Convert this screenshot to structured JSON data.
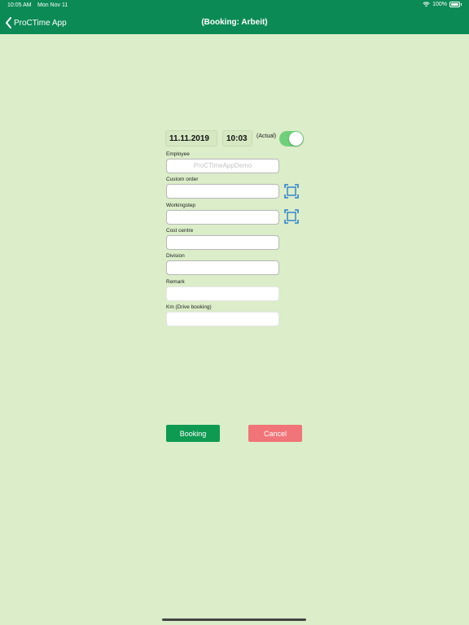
{
  "status": {
    "time": "10:05 AM",
    "date": "Mon Nov 11",
    "battery": "100%"
  },
  "nav": {
    "back_label": "ProCTime App",
    "title": "(Booking: Arbeit)"
  },
  "booking": {
    "date": "11.11.2019",
    "time": "10:03",
    "actual_label": "(Actual)",
    "actual_on": true
  },
  "fields": {
    "employee_label": "Employee",
    "employee_placeholder": "ProCTimeAppDemo",
    "custom_order_label": "Custom order",
    "workingstep_label": "Workingstep",
    "cost_centre_label": "Cost centre",
    "division_label": "Division",
    "remark_label": "Remark",
    "km_label": "Km (Drive booking)"
  },
  "buttons": {
    "booking": "Booking",
    "cancel": "Cancel"
  },
  "colors": {
    "header": "#0c8a55",
    "background": "#dbedc9",
    "booking": "#0f9a52",
    "cancel": "#f07478",
    "scan": "#2b7fd0"
  },
  "icons": [
    "chevron-left-icon",
    "wifi-icon",
    "battery-icon",
    "scan-icon"
  ]
}
